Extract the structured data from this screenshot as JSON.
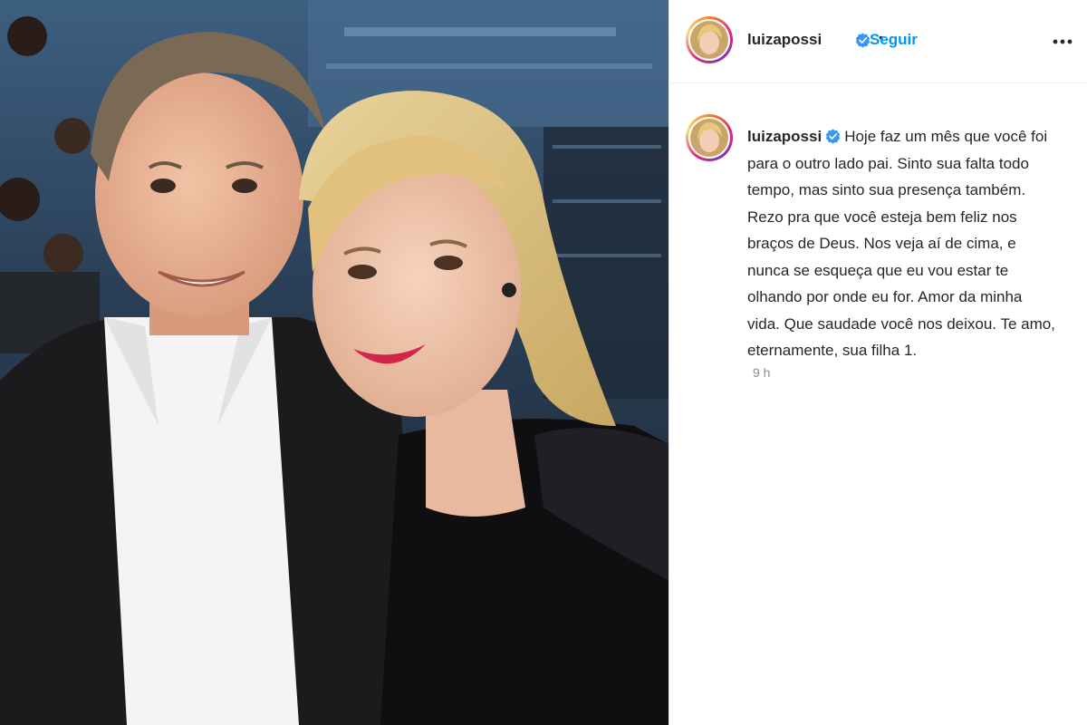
{
  "post": {
    "author": {
      "username": "luizapossi",
      "verified": true,
      "follow_label": "Seguir"
    },
    "header_separator": "•",
    "more_icon": "more-horizontal-icon",
    "caption": {
      "username": "luizapossi",
      "text": "Hoje faz um mês que você foi para o outro lado pai. Sinto sua falta todo tempo, mas sinto sua presença também. Rezo pra que você esteja bem feliz nos braços de Deus. Nos veja aí de cima, e nunca se esqueça que eu vou estar te olhando por onde eu for. Amor da minha vida. Que saudade você nos deixou. Te amo, eternamente, sua filha 1."
    },
    "timestamp": "9 h",
    "colors": {
      "follow_blue": "#0095f6",
      "verified_blue": "#3897f0",
      "text": "#262626",
      "muted": "#8e8e8e"
    }
  }
}
